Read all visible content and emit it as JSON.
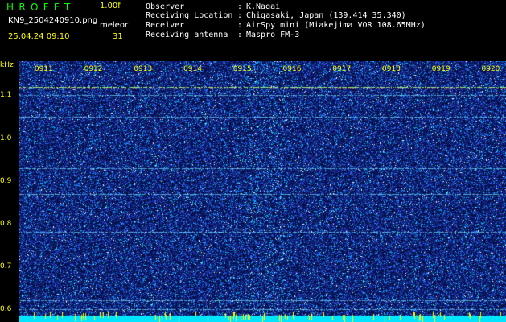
{
  "header": {
    "app_title": "HROFFT",
    "version": "1.00f",
    "filename": "KN9_2504240910.png",
    "mode": "meleor",
    "datetime": "25.04.24 09:10",
    "count": "31",
    "info": [
      {
        "label": "Observer",
        "value": "K.Nagai"
      },
      {
        "label": "Receiving Location",
        "value": "Chigasaki, Japan (139.414 35.340)"
      },
      {
        "label": "Receiver",
        "value": "AirSpy mini (Miakejima VOR 108.65MHz)"
      },
      {
        "label": "Receiving antenna",
        "value": "Maspro FM-3"
      }
    ],
    "separator": ":"
  },
  "colors": {
    "background": "#000000",
    "title": "#00ff00",
    "label_yellow": "#ffff00",
    "text": "#ffffff",
    "noise_base": "#1a2a8c",
    "noise_hot": "#00d8ff",
    "bottom_band": "#00e5ff"
  },
  "chart_data": {
    "type": "heatmap",
    "ylabel": "kHz",
    "y_ticks": [
      "1.1",
      "1.0",
      "0.9",
      "0.8",
      "0.7",
      "0.6"
    ],
    "y_tick_values": [
      1.1,
      1.0,
      0.9,
      0.8,
      0.7,
      0.6
    ],
    "ylim": [
      0.57,
      1.18
    ],
    "x_ticks": [
      "0911",
      "0912",
      "0913",
      "0914",
      "0915",
      "0916",
      "0917",
      "0918",
      "0919",
      "0920"
    ],
    "x_tick_values": [
      911,
      912,
      913,
      914,
      915,
      916,
      917,
      918,
      919,
      920
    ],
    "xlim": [
      910.5,
      920.3
    ],
    "carrier_lines_khz": [
      1.12,
      1.1,
      1.05,
      0.93,
      0.87,
      0.78,
      0.62,
      0.6
    ],
    "meteor_columns_min": [
      915.2,
      916.0
    ]
  }
}
